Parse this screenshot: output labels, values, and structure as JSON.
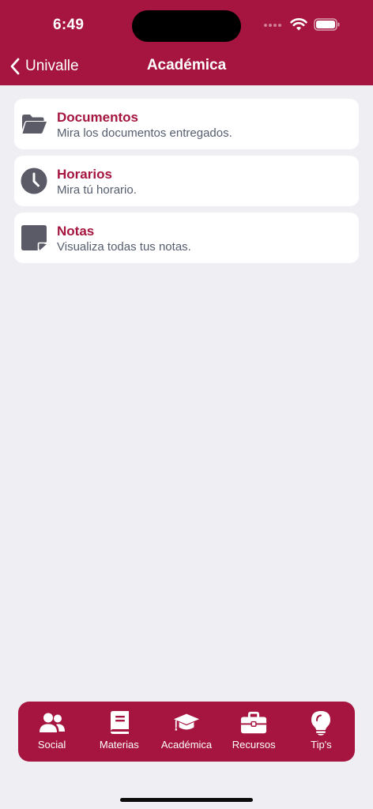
{
  "status_bar": {
    "time": "6:49"
  },
  "nav": {
    "back_label": "Univalle",
    "title": "Académica"
  },
  "items": [
    {
      "title": "Documentos",
      "subtitle": "Mira los documentos entregados.",
      "icon": "folder-icon"
    },
    {
      "title": "Horarios",
      "subtitle": "Mira tú horario.",
      "icon": "clock-icon"
    },
    {
      "title": "Notas",
      "subtitle": "Visualiza todas tus notas.",
      "icon": "sticky-note-icon"
    }
  ],
  "tabbar": {
    "tabs": [
      {
        "label": "Social",
        "icon": "users-icon"
      },
      {
        "label": "Materias",
        "icon": "book-icon"
      },
      {
        "label": "Académica",
        "icon": "graduation-cap-icon"
      },
      {
        "label": "Recursos",
        "icon": "briefcase-icon"
      },
      {
        "label": "Tip's",
        "icon": "lightbulb-icon"
      }
    ]
  },
  "colors": {
    "brand": "#a5153f",
    "background": "#efeef3",
    "card": "#ffffff",
    "icon_gray": "#5a5b66",
    "subtitle": "#555d6e"
  }
}
